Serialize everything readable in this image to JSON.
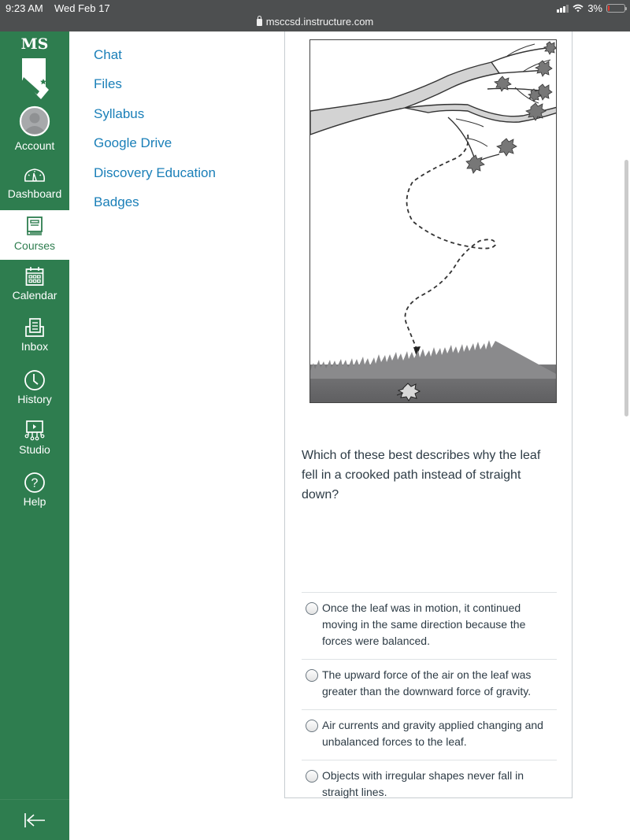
{
  "status_bar": {
    "time": "9:23 AM",
    "date": "Wed Feb 17",
    "url": "msccsd.instructure.com",
    "battery": "3%",
    "battery_level_percent": 3
  },
  "global_nav": {
    "logo_text": "MS",
    "items": [
      {
        "label": "Account",
        "icon": "avatar-icon"
      },
      {
        "label": "Dashboard",
        "icon": "speedometer-icon"
      },
      {
        "label": "Courses",
        "icon": "book-icon",
        "active": true
      },
      {
        "label": "Calendar",
        "icon": "calendar-icon"
      },
      {
        "label": "Inbox",
        "icon": "inbox-icon"
      },
      {
        "label": "History",
        "icon": "clock-icon"
      },
      {
        "label": "Studio",
        "icon": "studio-icon"
      },
      {
        "label": "Help",
        "icon": "help-icon"
      }
    ],
    "collapse_icon": "collapse-arrow-icon"
  },
  "course_nav": {
    "links": [
      "Chat",
      "Files",
      "Syllabus",
      "Google Drive",
      "Discovery Education",
      "Badges"
    ]
  },
  "content": {
    "figure_alt": "Leaf falling from tree branch in a crooked dashed path to the grass",
    "question": "Which of these best describes why the leaf fell in a crooked path instead of straight down?",
    "answers": [
      "Once the leaf was in motion, it continued moving in the same direction because the forces were balanced.",
      "The upward force of the air on the leaf was greater than the downward force of gravity.",
      "Air currents and gravity applied changing and unbalanced forces to the leaf.",
      "Objects with irregular shapes never fall in straight lines."
    ]
  },
  "colors": {
    "nav_green": "#2e7d4f",
    "link_blue": "#1a7fb8",
    "text_dark": "#2d3b45"
  }
}
